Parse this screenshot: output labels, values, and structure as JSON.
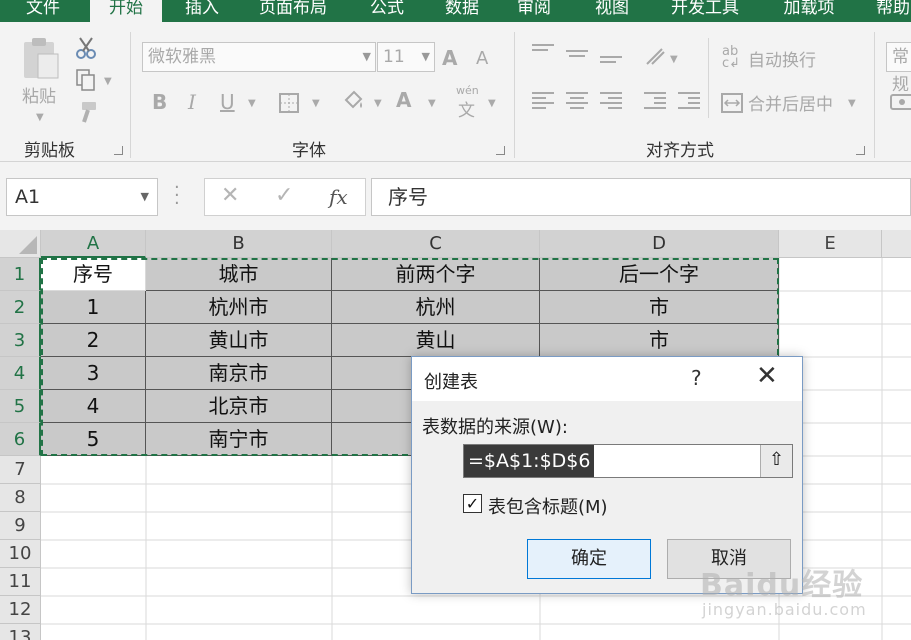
{
  "ribbon": {
    "tabs": [
      "文件",
      "开始",
      "插入",
      "页面布局",
      "公式",
      "数据",
      "审阅",
      "视图",
      "开发工具",
      "加载项",
      "帮助"
    ],
    "active_tab": "开始",
    "clipboard": {
      "paste_label": "粘贴",
      "group_label": "剪贴板"
    },
    "font": {
      "font_name": "微软雅黑",
      "font_size": "11",
      "bold": "B",
      "italic": "I",
      "underline": "U",
      "font_color_letter": "A",
      "increase_font": "A",
      "decrease_font": "A",
      "phonetic_top": "wén",
      "phonetic_bottom": "文",
      "group_label": "字体"
    },
    "alignment": {
      "wrap_text": "自动换行",
      "merge_center": "合并后居中",
      "group_label": "对齐方式"
    },
    "number": {
      "format": "常规"
    }
  },
  "formula_bar": {
    "name_box": "A1",
    "cancel_symbol": "✕",
    "enter_symbol": "✓",
    "fx_symbol": "fx",
    "content": "序号"
  },
  "grid": {
    "columns": [
      "A",
      "B",
      "C",
      "D",
      "E"
    ],
    "rows": [
      "1",
      "2",
      "3",
      "4",
      "5",
      "6",
      "7",
      "8",
      "9",
      "10",
      "11",
      "12",
      "13"
    ],
    "header_row": [
      "序号",
      "城市",
      "前两个字",
      "后一个字"
    ],
    "data_rows": [
      [
        "1",
        "杭州市",
        "杭州",
        "市"
      ],
      [
        "2",
        "黄山市",
        "黄山",
        "市"
      ],
      [
        "3",
        "南京市",
        "",
        ""
      ],
      [
        "4",
        "北京市",
        "",
        ""
      ],
      [
        "5",
        "南宁市",
        "",
        ""
      ]
    ]
  },
  "dialog": {
    "title": "创建表",
    "help": "?",
    "close": "✕",
    "source_label": "表数据的来源(W):",
    "source_value": "=$A$1:$D$6",
    "collapse_symbol": "⇧",
    "has_headers_label": "表包含标题(M)",
    "has_headers_checked": true,
    "check_mark": "✓",
    "ok_label": "确定",
    "cancel_label": "取消"
  },
  "watermark": {
    "main": "Baidu经验",
    "sub": "jingyan.baidu.com"
  },
  "colors": {
    "excel_green": "#217346",
    "selection_fill": "#c9c9c9",
    "dialog_ok_border": "#0078d7"
  }
}
